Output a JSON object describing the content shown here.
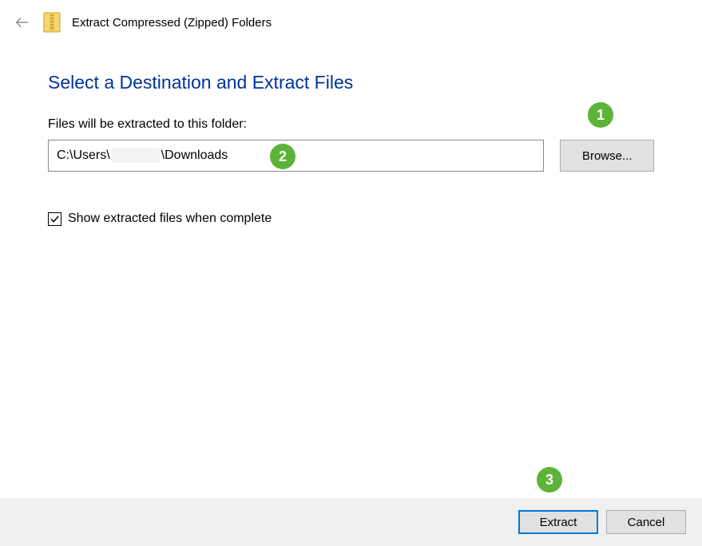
{
  "header": {
    "window_title": "Extract Compressed (Zipped) Folders"
  },
  "main": {
    "page_title": "Select a Destination and Extract Files",
    "field_label": "Files will be extracted to this folder:",
    "path_prefix": "C:\\Users\\",
    "path_suffix": "\\Downloads",
    "browse_label": "Browse...",
    "checkbox_label": "Show extracted files when complete",
    "checkbox_checked": true
  },
  "footer": {
    "extract_label": "Extract",
    "cancel_label": "Cancel"
  },
  "annotations": {
    "badge1": "1",
    "badge2": "2",
    "badge3": "3"
  }
}
